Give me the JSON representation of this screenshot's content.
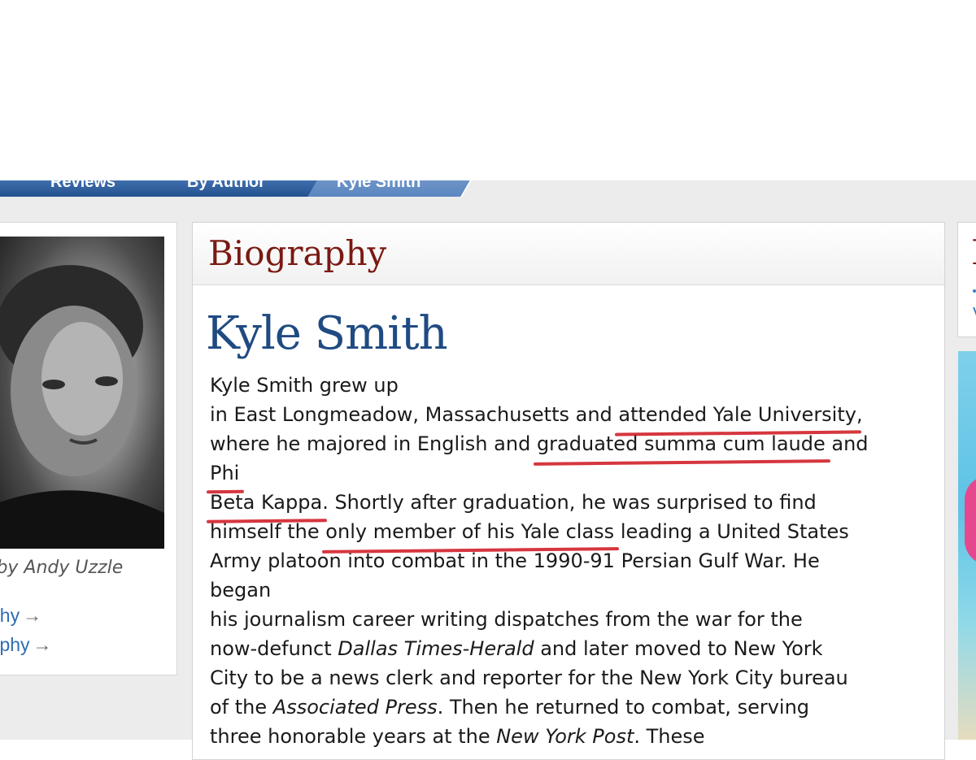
{
  "breadcrumb": {
    "items": [
      "Reviews",
      "By Author",
      "Kyle Smith"
    ]
  },
  "sidebar": {
    "photo_credit": "o by Andy Uzzle",
    "links": [
      "phy",
      "raphy"
    ],
    "arrow": "→"
  },
  "main": {
    "section_heading": "Biography",
    "author_name": "Kyle Smith",
    "bio_lines": [
      "Kyle Smith grew up",
      "in East Longmeadow, Massachusetts and ",
      "attended Yale University",
      ",",
      "where he majored in English and ",
      "graduated summa cum laude",
      " and",
      "Phi",
      "Beta Kappa",
      ". Shortly after graduation, he was surprised to find",
      "himself the ",
      "only member of his Yale class",
      " leading a United States",
      "Army platoon into combat in the 1990-91 Persian Gulf War. He",
      "began",
      "his journalism career writing dispatches from the war for the",
      "now-defunct ",
      "Dallas Times-Herald",
      " and later moved to New York",
      "City to be a news clerk and reporter for the New York City bureau",
      "of the ",
      "Associated Press",
      ". Then he returned to combat, serving",
      "three honorable years at the ",
      "New York Post",
      ". These"
    ]
  },
  "right_panel": {
    "heading_letter": "B",
    "link_letter": "V"
  },
  "colors": {
    "heading": "#7a1a12",
    "author_name": "#1f4b82",
    "link": "#2f6db4",
    "annotation_underline": "#d6363e",
    "breadcrumb": "#24528f"
  }
}
